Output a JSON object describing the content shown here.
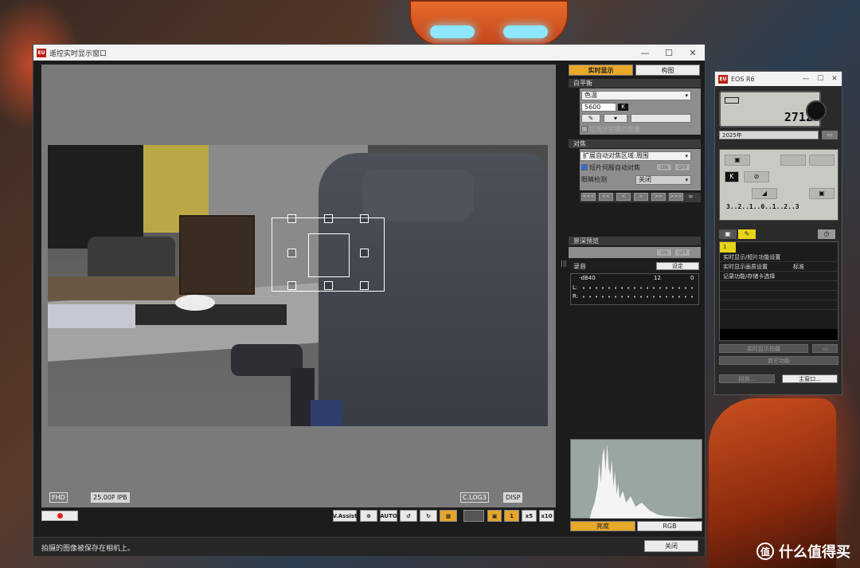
{
  "watermark": {
    "logo_glyph": "值",
    "text": "什么值得买"
  },
  "main_window": {
    "title": "遥控实时显示窗口",
    "app_icon_text": "EU",
    "controls": {
      "minimize": "—",
      "maximize": "☐",
      "close": "✕"
    },
    "liveview_indicators": {
      "quality": "FHD",
      "fps": "25.00P",
      "codec": "IPB",
      "log": "C.LOG3",
      "disp": "DISP"
    },
    "toolbar": {
      "vassist": "V.Assist",
      "af_target": "⊕",
      "auto": "AUTO",
      "rotate_left": "↺",
      "rotate_right": "↻",
      "grid": "▦",
      "zoom_fit": "▣",
      "zoom_1": "1",
      "zoom_5": "x5",
      "zoom_10": "x10"
    },
    "status_text": "拍摄的图像被保存在相机上。",
    "close_label": "关闭",
    "tabs": {
      "live": "实时显示",
      "compose": "构图"
    },
    "white_balance": {
      "title": "白平衡",
      "mode": "色温",
      "kelvin": "5600",
      "kelvin_unit": "K",
      "picker_glyph": "✎",
      "apply_label": "应用于拍摄的图像"
    },
    "focus": {
      "title": "对焦",
      "mode": "扩展自动对焦区域:周围",
      "movie_servo": "短片伺服自动对焦",
      "on": "ON",
      "off": "OFF",
      "eye_label": "眼睛检测",
      "eye_value": "关闭",
      "nav": [
        "<<<",
        "<<",
        "<",
        ">",
        ">>",
        ">>>"
      ],
      "infinity": "∞"
    },
    "dof": {
      "title": "景深预览",
      "on": "ON",
      "off": "OFF"
    },
    "audio": {
      "title": "录音",
      "settings_label": "设定",
      "scale_left": "-dB40",
      "scale_mid": "12",
      "scale_right": "0",
      "left_ch": "L:",
      "right_ch": "R:"
    },
    "histogram_tabs": {
      "brightness": "亮度",
      "rgb": "RGB"
    }
  },
  "camera_window": {
    "title": "EOS R6",
    "app_icon_text": "EU",
    "controls": {
      "minimize": "—",
      "maximize": "☐",
      "close": "✕"
    },
    "shots_remaining": "2712",
    "date_label": "2025年",
    "date_icon": "▭",
    "mode_k": "K",
    "exposure_scale": "3..2..1..0..1..2..3",
    "tabs": {
      "camera": "▣",
      "tools": "✎",
      "clock": "◷"
    },
    "menu_page": "1",
    "menu_items": [
      {
        "label": "实时显示/短片功能设置",
        "value": ""
      },
      {
        "label": "实时显示画质设置",
        "value": "标准"
      },
      {
        "label": "记录功能/存储卡选择",
        "value": ""
      }
    ],
    "liveview_btn": "实时显示拍摄",
    "other_label": "其它功能",
    "dust_btn": "回放...",
    "main_window_btn": "主窗口..."
  }
}
